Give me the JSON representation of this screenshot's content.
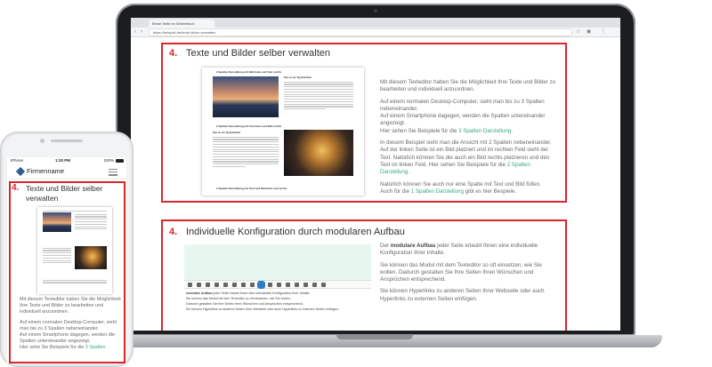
{
  "browser": {
    "tab_title": "Beste Seite im Wörterbuch",
    "url": "https://beispiel.de/texte-bilder-verwalten"
  },
  "section1": {
    "number": "4.",
    "title": "Texte und Bilder selber verwalten",
    "doc": {
      "heading1": "2 Spalten Darstellung mit Bild links und Text rechts",
      "subheading": "Dies ist ein Typoblindtext",
      "heading2": "2 Spalten Darstellung mit Text links und Bild rechts",
      "subheading2": "Dies ist ein Typoblindtext",
      "heading3": "2 Spalten Darstellung mit Text und Bild links und rechts"
    },
    "paragraphs": {
      "p1": "Mit diesem Texteditor haben Sie die Möglichkeit Ihre Texte und Bilder zu bearbeiten und individuell anzuordnen.",
      "p2": "Auf einem normalen Desktop-Computer, sieht man bis zu 3 Spalten nebeneinander.",
      "p3": "Auf einem Smartphone dagegen, werden die Spalten untereinander angezeigt.",
      "p4_text": "Hier sehen Sie Beispiele für die ",
      "p4_link": "3 Spalten Darstellung.",
      "p5": "In diesem Beispiel sieht man die Ansicht mit 2 Spalten nebeneinander. Auf der linken Seite ist ein Bild platziert und im rechten Feld steht der Text. Natürlich können Sie die auch ein Bild rechts platzieren und den Text im linken Feld. Hier sehen Sie Beispiele für die ",
      "p5_link": "2 Spalten Darstellung.",
      "p6": "Natürlich können Sie auch nur eine Spalte mit Text und Bild füllen.",
      "p7_text": "Auch für die ",
      "p7_link": "1 Spalten Darstellung",
      "p7_end": " gibt es hier Bespiele."
    }
  },
  "section2": {
    "number": "4.",
    "title": "Individuelle Konfiguration durch modularen Aufbau",
    "p1_pre": "Der ",
    "p1_bold": "modulare Aufbau",
    "p1_post": " jeder Seite erlaubt Ihnen eine individuelle Konfiguration Ihrer Inhalte.",
    "p2": "Sie können das Modul mit dem Texteditor so oft einsetzen, wie Sie wollen. Dadurch gestalten Sie Ihre Seiten Ihren Wünschen und Ansprüchen entsprechend.",
    "p3": "Sie können Hyperlinks zu anderen Seiten Ihrer Webseite oder auch Hyperlinks zu externen Seiten einfügen.",
    "editor_line1_bold": "modulare Aufbau",
    "editor_line1": " jeder Seite erlaubt Ihnen eine individuelle Konfiguration Ihrer Inhalte.",
    "editor_line2": "Sie können das Modul mit dem Texteditor so oft einsetzen, wie Sie wollen.",
    "editor_line3": "Dadurch gestalten Sie Ihre Seiten Ihren Wünschen und Ansprüchen entsprechend.",
    "editor_line4": "Sie können Hyperlinks zu anderen Seiten Ihrer Webseite oder auch Hyperlinks zu externen Seiten einfügen."
  },
  "phone": {
    "carrier": "iPhone",
    "time": "1:20 PM",
    "battery": "100%",
    "brand": "Firmenname",
    "number": "4.",
    "title": "Texte und Bilder selber verwalten",
    "p1": "Mit diesem Texteditor haben Sie die Möglichkeit Ihre Texte und Bilder zu bearbeiten und individuell anzuordnen.",
    "p2": "Auf einem normalen Desktop-Computer, sieht man bis zu 3 Spalten nebeneinander.",
    "p3": "Auf einem Smartphone dagegen, werden die Spalten untereinander angezeigt.",
    "p4_text": "Hier sehe Sie Beispiele für die ",
    "p4_link": "3 Spalten"
  },
  "colors": {
    "accent_red": "#d9262a",
    "link_green": "#3aa88a"
  }
}
